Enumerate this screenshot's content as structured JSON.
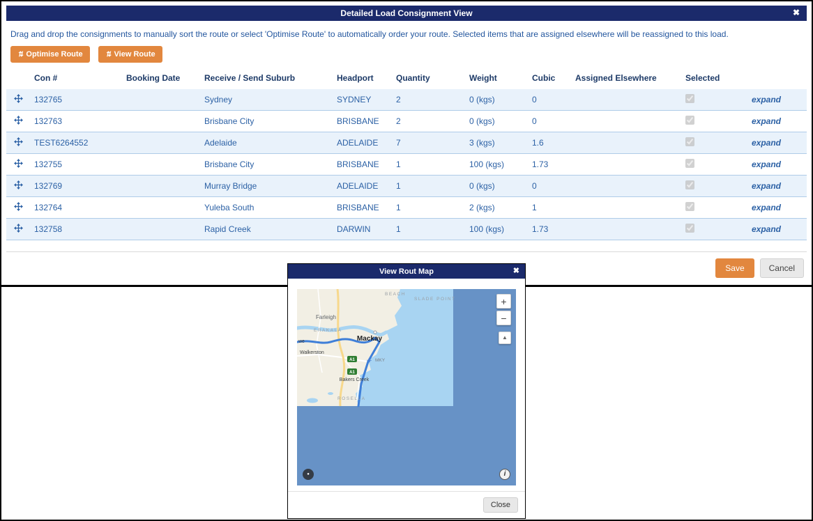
{
  "icons": {
    "close": "✖",
    "route_button": "⇅",
    "zoom_in": "+",
    "zoom_out": "−",
    "tilt": "▲",
    "pegman": "●",
    "info": "i",
    "airplane": "✈"
  },
  "colors": {
    "header_navy": "#1b2a6b",
    "accent_orange": "#e2873e",
    "table_blue": "#2c61a5",
    "row_stripe": "#e9f2fb",
    "map_ocean_deep": "#6792c6",
    "map_ocean_light": "#a8d4f2",
    "map_land": "#f2efe4"
  },
  "consignment_modal": {
    "title": "Detailed Load Consignment View",
    "instructions": "Drag and drop the consignments to manually sort the route or select 'Optimise Route' to automatically order your route. Selected items that are assigned elsewhere will be reassigned to this load.",
    "buttons": {
      "optimise": "Optimise Route",
      "view": "View Route"
    },
    "table": {
      "headers": {
        "con": "Con #",
        "booking_date": "Booking Date",
        "suburb": "Receive / Send Suburb",
        "headport": "Headport",
        "quantity": "Quantity",
        "weight": "Weight",
        "cubic": "Cubic",
        "assigned": "Assigned Elsewhere",
        "selected": "Selected"
      },
      "expand_label": "expand",
      "rows": [
        {
          "con": "132765",
          "booking_date": "",
          "suburb": "Sydney",
          "headport": "SYDNEY",
          "quantity": "2",
          "weight": "0 (kgs)",
          "cubic": "0",
          "assigned": "",
          "selected": true
        },
        {
          "con": "132763",
          "booking_date": "",
          "suburb": "Brisbane City",
          "headport": "BRISBANE",
          "quantity": "2",
          "weight": "0 (kgs)",
          "cubic": "0",
          "assigned": "",
          "selected": true
        },
        {
          "con": "TEST6264552",
          "booking_date": "",
          "suburb": "Adelaide",
          "headport": "ADELAIDE",
          "quantity": "7",
          "weight": "3 (kgs)",
          "cubic": "1.6",
          "assigned": "",
          "selected": true
        },
        {
          "con": "132755",
          "booking_date": "",
          "suburb": "Brisbane City",
          "headport": "BRISBANE",
          "quantity": "1",
          "weight": "100 (kgs)",
          "cubic": "1.73",
          "assigned": "",
          "selected": true
        },
        {
          "con": "132769",
          "booking_date": "",
          "suburb": "Murray Bridge",
          "headport": "ADELAIDE",
          "quantity": "1",
          "weight": "0 (kgs)",
          "cubic": "0",
          "assigned": "",
          "selected": true
        },
        {
          "con": "132764",
          "booking_date": "",
          "suburb": "Yuleba South",
          "headport": "BRISBANE",
          "quantity": "1",
          "weight": "2 (kgs)",
          "cubic": "1",
          "assigned": "",
          "selected": true
        },
        {
          "con": "132758",
          "booking_date": "",
          "suburb": "Rapid Creek",
          "headport": "DARWIN",
          "quantity": "1",
          "weight": "100 (kgs)",
          "cubic": "1.73",
          "assigned": "",
          "selected": true
        }
      ]
    },
    "footer": {
      "save": "Save",
      "cancel": "Cancel"
    }
  },
  "map_modal": {
    "title": "View Rout Map",
    "close_button": "Close",
    "map": {
      "labels": {
        "beach": "BEACH",
        "slade_point": "SLADE POINT",
        "farleigh": "Farleigh",
        "erakala": "ERAKALA",
        "mackay": "Mackay",
        "we": "we",
        "walkerston": "Walkerston",
        "airport": "MKY",
        "shield": "A1",
        "bakers_creek": "Bakers Creek",
        "rosella": "ROSELLA"
      }
    }
  }
}
